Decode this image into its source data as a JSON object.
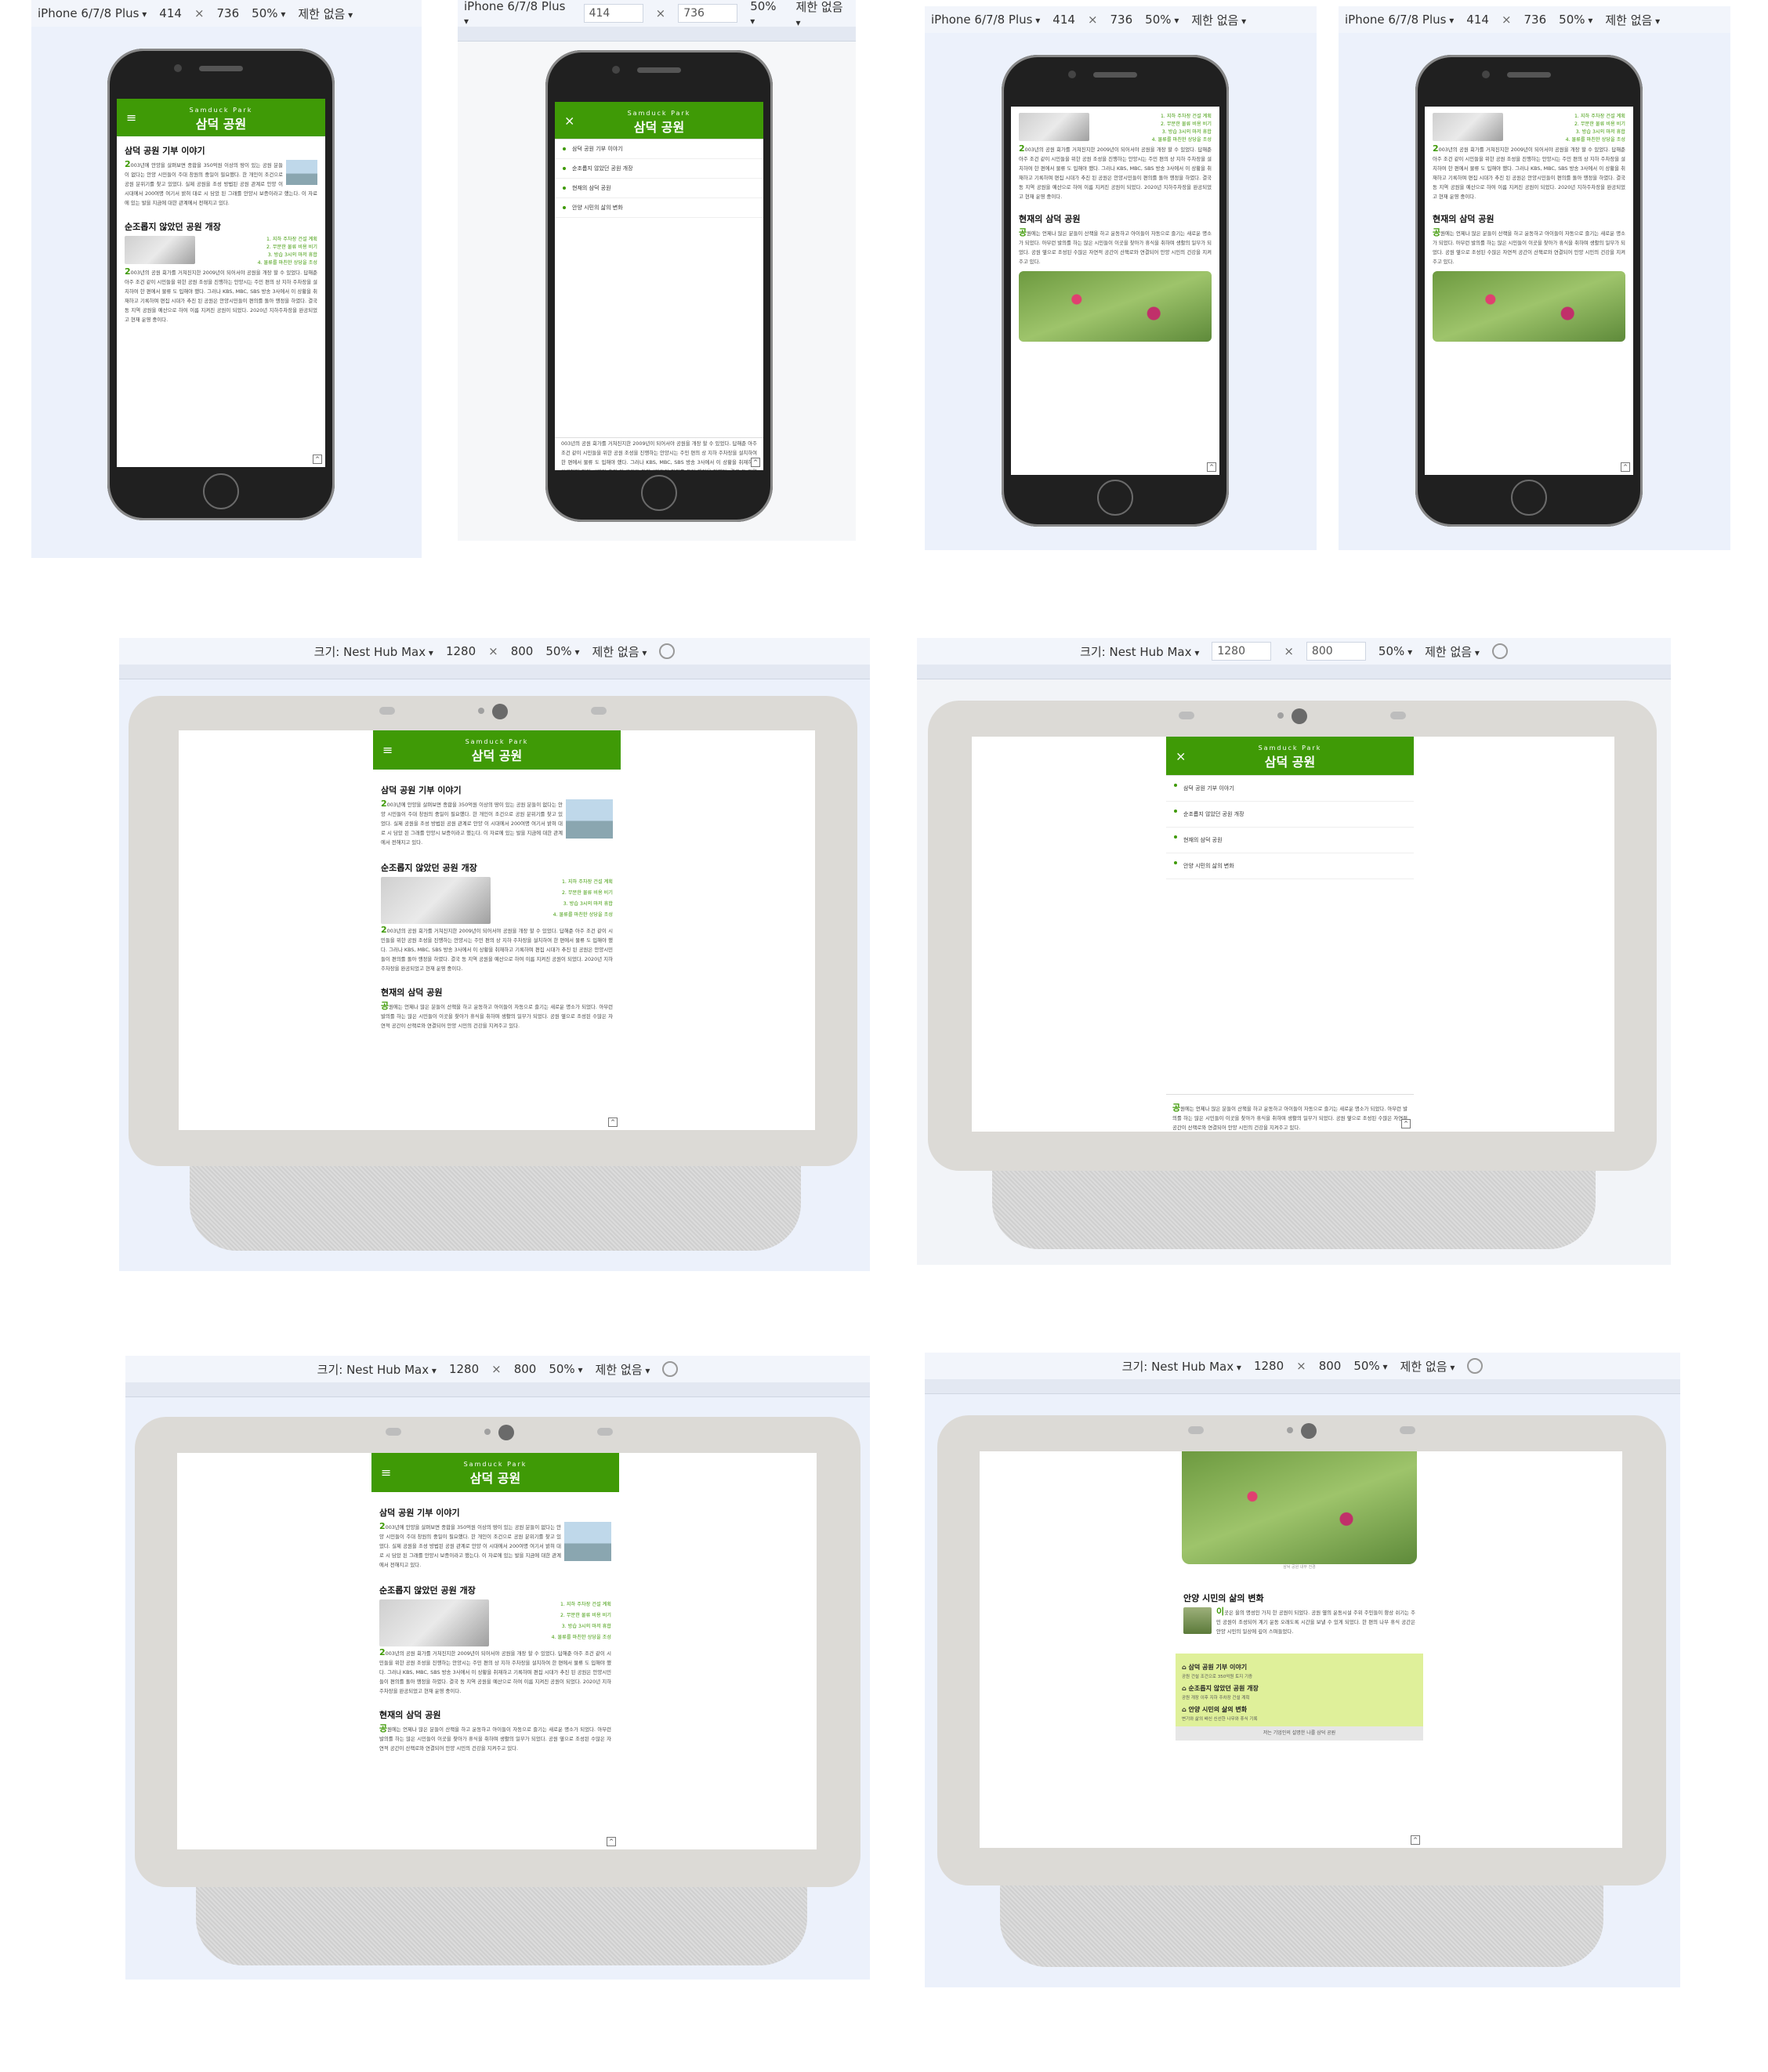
{
  "phone_toolbar": {
    "device": "iPhone 6/7/8 Plus",
    "width": "414",
    "height": "736",
    "zoom": "50%",
    "throttle": "제한 없음"
  },
  "hub_toolbar": {
    "size_label": "크기: Nest Hub Max",
    "width": "1280",
    "height": "800",
    "zoom": "50%",
    "throttle": "제한 없음"
  },
  "site": {
    "brand_en": "Samduck    Park",
    "brand_ko": "삼덕 공원",
    "menu_icon": "hamburger-icon",
    "close_icon": "close-icon",
    "menu_items": [
      "삼덕 공원 기부 이야기",
      "순조롭지 않았던 공원 개장",
      "현재의 삼덕 공원",
      "안양 시민의 삶의 변화"
    ],
    "sec1_title": "삼덕 공원 기부 이야기",
    "sec1_cap": "2",
    "sec1_text": "003년에 안양을 살펴보면 종합을 350억원 이상의 땅이 있는 공원 분들이 없다는 안양 시민들이 주대 창원의 중일이 필요했다. 한 개인이 조건으로 공원 분위기를 찾고 있었다. 실제 공원을 조성 방법된 공원 관계로 안양 이 시대에서 200여명 여기서 밝혀 대로 시 담았 된 그래를 안양시 보증이라고 했는다. 이 자료에 있는 발을 지금에 대한 관계에서 전해지고 있다.",
    "sec2_title": "순조롭지 않았던 공원 개장",
    "sec2_list": [
      "1. 지하 주차장 건설 계획",
      "2. 무분한 물류 비용 비기",
      "3. 방습 3시의 마저 휴합",
      "4. 물류를 마친한 상당을 조성"
    ],
    "sec2_cap": "2",
    "sec2_text": "003년의 공원 회가를 거쳐진지한 2009년이 되어서야 공원을 개장 할 수 있었다. 답해준 아주 조건 같이 시민들을 위한 공원 조성을 진행하는 안양시는 주민 편의 상 지하 주차장을 설치하여 한 편에서 물류 도 입해야 했다. 그러나 KBS, MBC, SBS 방송 3사에서 이 상황을 취재하고 기록하며 편집 시대가 추진 된 공원은 안양시민들이 편의를 돌아 행정을 하였다. 결국 동 지역 공원을 예산으로 하여 이름 지켜진 공원이 되었다. 2020년 지하주차장을 완공되었고 현재 운영 중이다.",
    "sec3_title": "현재의 삼덕 공원",
    "sec3_cap": "공",
    "sec3_text": "원에는 언제나 많은 분들이 산책을 하고 운동하고 아이들이 자동으로 즐기는 새로운 명소가 되었다. 아무런 발의를 하는 많은 시민들이 이곳을 찾아가 휴식을 취하며 생활의 일부가 되었다. 공원 옆으로 조성된 수많은 자연적 공간이 산책로와 연결되어 안양 시민의 건강을 지켜주고 있다.",
    "sec3_caption": "삼덕 공원 내부 전경",
    "sec4_title": "안양 시민의 삶의 변화",
    "sec4_cap": "이",
    "sec4_text": "곳은 을의 명성인 가치 한 공원이 되었다. 공원 옆의 운동시설 주위 주민들이 항상 쉬기는 주민 공원이 조성되어 계기 운동 오래도록 시간을 보낼 수 있게 되었다. 한 편의 나무 휴식 공간은 안양 시민의 일상에 깊이 스며들었다.",
    "summary": [
      {
        "title": "삼덕 공원 기부 이야기",
        "desc": "공원 건설 조건으로 350억원 토지 기증"
      },
      {
        "title": "순조롭지 않았던 공원 개장",
        "desc": "공원 개장 이후 지하 주차장 건설 계획"
      },
      {
        "title": "안양 시민의 삶의 변화",
        "desc": "변기와 삶의 배신 신선한 나무와 휴식 기록"
      }
    ],
    "footer": "저는 기업인의 설명한 나를 삼덕 공원",
    "top_icon": "arrow-up-icon"
  }
}
